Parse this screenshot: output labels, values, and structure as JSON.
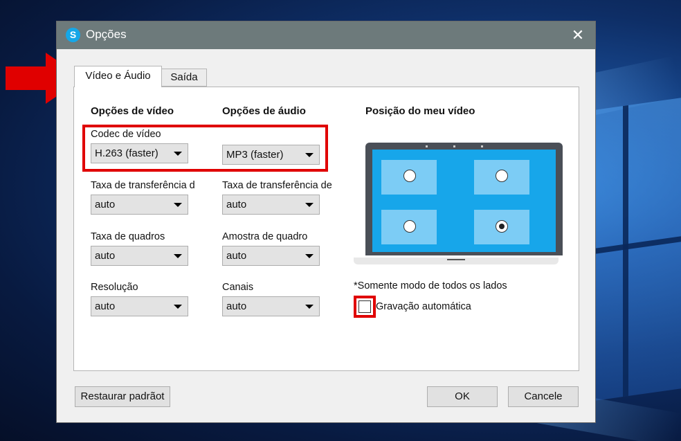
{
  "window": {
    "title": "Opções",
    "app_icon_glyph": "S"
  },
  "tabs": [
    {
      "label": "Vídeo e Áudio",
      "active": true
    },
    {
      "label": "Saída",
      "active": false
    }
  ],
  "video": {
    "heading": "Opções de vídeo",
    "codec": {
      "label": "Codec de vídeo",
      "value": "H.263 (faster)"
    },
    "bitrate": {
      "label": "Taxa de transferência d",
      "value": "auto"
    },
    "framerate": {
      "label": "Taxa de quadros",
      "value": "auto"
    },
    "resolution": {
      "label": "Resolução",
      "value": "auto"
    }
  },
  "audio": {
    "heading": "Opções de áudio",
    "codec": {
      "value": "MP3 (faster)"
    },
    "bitrate": {
      "label": "Taxa de transferência de",
      "value": "auto"
    },
    "sample": {
      "label": "Amostra de quadro",
      "value": "auto"
    },
    "channels": {
      "label": "Canais",
      "value": "auto"
    }
  },
  "position": {
    "heading": "Posição do meu vídeo",
    "selected": "bottom-right",
    "note": "*Somente modo de todos os lados",
    "auto_record": {
      "label": "Gravação automática",
      "checked": false
    }
  },
  "buttons": {
    "restore": "Restaurar padrãot",
    "ok": "OK",
    "cancel": "Cancele"
  },
  "colors": {
    "titlebar": "#6d7a7b",
    "highlight": "#e00000",
    "screen_blue": "#17a6ea"
  }
}
